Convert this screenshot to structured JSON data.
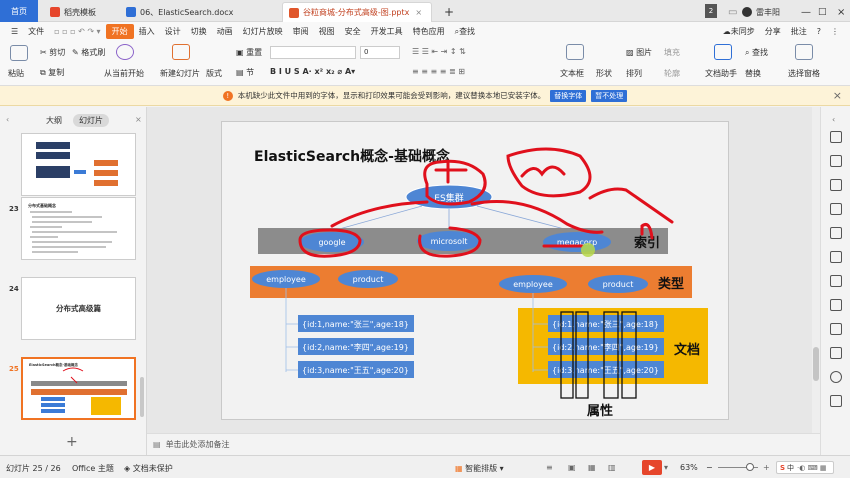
{
  "tabs": {
    "home": "首页",
    "tab1": "稻壳模板",
    "tab2": "06、ElasticSearch.docx",
    "tab3": "谷粒商城-分布式高级-图.pptx",
    "new_tab": "+"
  },
  "titlebar": {
    "badge": "2",
    "user": "雷丰阳"
  },
  "menu": {
    "file": "文件",
    "items": [
      "开始",
      "插入",
      "设计",
      "切换",
      "动画",
      "幻灯片放映",
      "审阅",
      "视图",
      "安全",
      "开发工具",
      "特色应用"
    ],
    "search": "查找",
    "sync": "未同步",
    "share": "分享",
    "comment": "批注",
    "help": "?"
  },
  "ribbon": {
    "paste": "粘贴",
    "cut": "剪切",
    "copy": "复制",
    "format_painter": "格式刷",
    "from_start": "从当前开始",
    "new_slide": "新建幻灯片",
    "layout": "版式",
    "section": "节",
    "reset": "重置",
    "textbox": "文本框",
    "shape": "形状",
    "arrange": "排列",
    "picture": "图片",
    "fill": "填充",
    "outline": "轮廓",
    "find": "查找",
    "replace": "替换",
    "doc_assistant": "文档助手",
    "select_pane": "选择窗格",
    "font_size": "0"
  },
  "warning": {
    "text": "本机缺少此文件中用到的字体，显示和打印效果可能会受到影响，建议替换本地已安装字体。",
    "btn_replace": "替换字体",
    "btn_ignore": "暂不处理",
    "close": "×"
  },
  "leftpane": {
    "tab_outline": "大纲",
    "tab_slides": "幻灯片",
    "slides": [
      {
        "num": "",
        "text": ""
      },
      {
        "num": "23",
        "text": "分布式基础概念"
      },
      {
        "num": "24",
        "text": "分布式高级篇"
      },
      {
        "num": "25",
        "text": "ElasticSearch概念-基础概念"
      }
    ],
    "add": "+"
  },
  "slide": {
    "title": "ElasticSearch概念-基础概念",
    "cluster": "ES集群",
    "indices": [
      "google",
      "microsolt",
      "megacorp"
    ],
    "index_label": "索引",
    "types_left": [
      "employee",
      "product"
    ],
    "types_right": [
      "employee",
      "product"
    ],
    "type_label": "类型",
    "docs": [
      "{id:1,name:\"张三\",age:18}",
      "{id:2,name:\"李四\",age:19}",
      "{id:3,name:\"王五\",age:20}"
    ],
    "doc_label": "文档",
    "attr_label": "属性"
  },
  "notes": {
    "placeholder": "单击此处添加备注"
  },
  "status": {
    "slide_count": "幻灯片 25 / 26",
    "theme": "Office 主题",
    "protect": "文档未保护",
    "smart": "智能排版",
    "zoom": "63%",
    "ime": "中"
  },
  "colors": {
    "accent": "#f07323",
    "blue": "#2f6fd6",
    "ink": "#e0101c"
  }
}
